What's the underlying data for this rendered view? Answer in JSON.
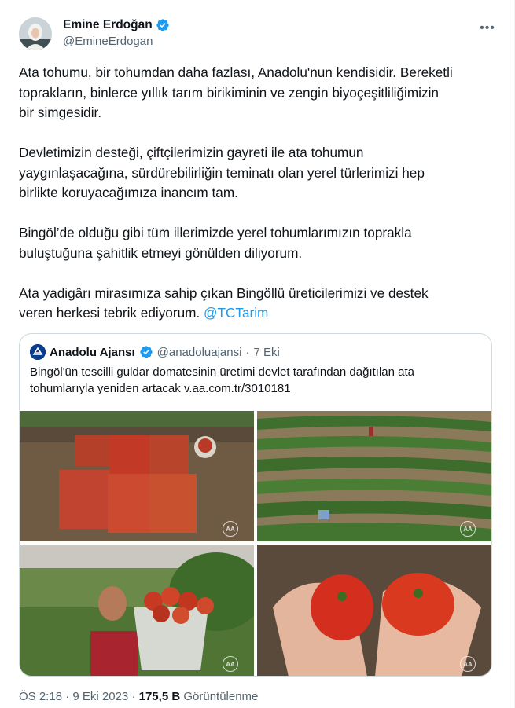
{
  "author": {
    "display_name": "Emine Erdoğan",
    "handle": "@EmineErdogan",
    "verified_icon": "verified-badge-icon",
    "more_icon": "more-options-icon"
  },
  "tweet": {
    "paragraphs": [
      "Ata tohumu, bir tohumdan daha fazlası, Anadolu'nun kendisidir. Bereketli\ntoprakların, binlerce yıllık tarım birikiminin ve zengin biyoçeşitliliğimizin\nbir simgesidir.",
      "Devletimizin desteği, çiftçilerimizin gayreti ile ata tohumun\nyaygınlaşacağına, sürdürebilirliğin teminatı olan yerel türlerimizi hep\nbirlikte koruyacağımıza inancım tam.",
      "Bingöl’de olduğu gibi tüm illerimizde yerel tohumlarımızın toprakla\nbuluştuğuna şahitlik etmeyi gönülden diliyorum."
    ],
    "last_paragraph_text": "Ata yadigârı mirasımıza sahip çıkan Bingöllü üreticilerimizi ve destek\nveren herkesi tebrik ediyorum. ",
    "mention": "@TCTarim"
  },
  "quote": {
    "display_name": "Anadolu Ajansı",
    "handle": "@anadoluajansi",
    "separator": "·",
    "date": "7 Eki",
    "text": "Bingöl'ün tescilli guldar domatesinin üretimi devlet tarafından dağıtılan ata tohumlarıyla yeniden artacak v.aa.com.tr/3010181",
    "watermark": "AA"
  },
  "meta": {
    "time": "ÖS 2:18",
    "separator": "·",
    "date": "9 Eki 2023",
    "separator2": "·",
    "views_count": "175,5 B",
    "views_label": "Görüntülenme"
  },
  "colors": {
    "link": "#1d9bf0",
    "secondary_text": "#536471",
    "border": "#cfd9de"
  }
}
